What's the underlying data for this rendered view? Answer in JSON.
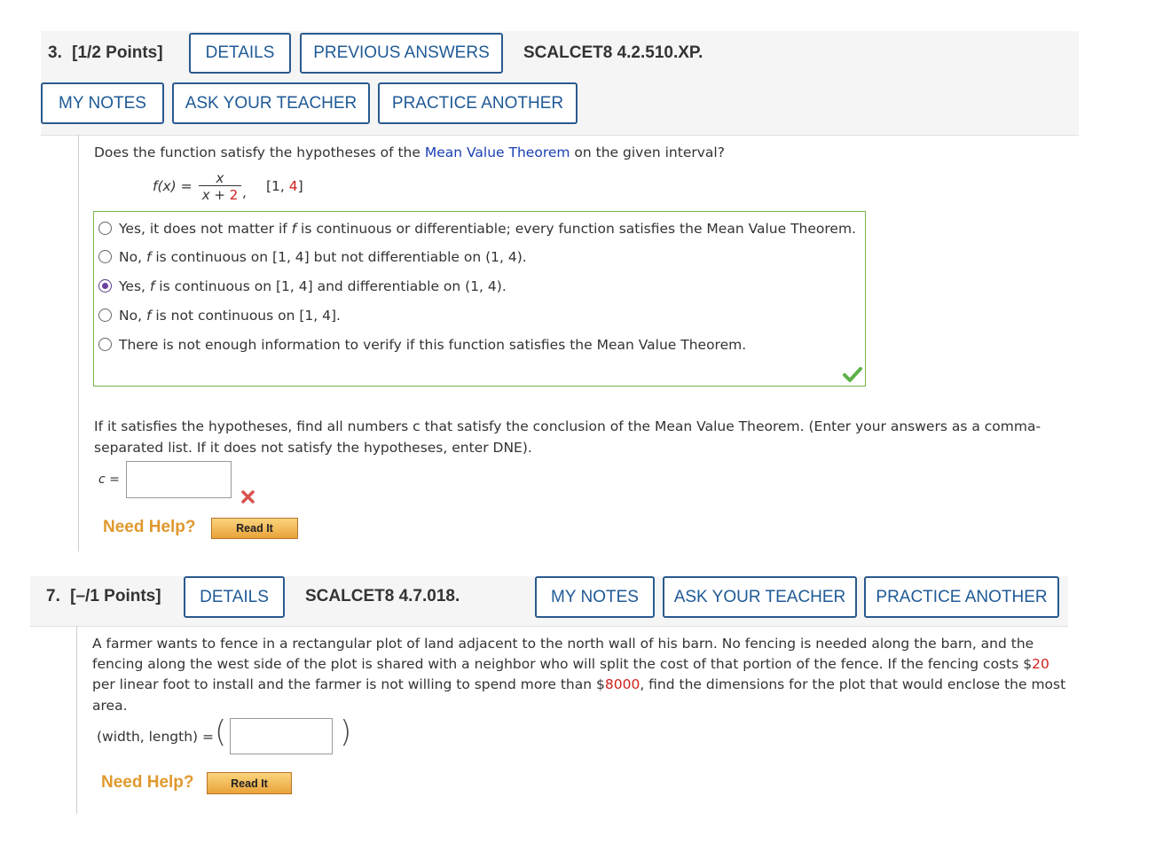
{
  "q3": {
    "number": "3.",
    "points": "[1/2 Points]",
    "details_label": "DETAILS",
    "previous_answers_label": "PREVIOUS ANSWERS",
    "code": "SCALCET8 4.2.510.XP.",
    "my_notes_label": "MY NOTES",
    "ask_teacher_label": "ASK YOUR TEACHER",
    "practice_another_label": "PRACTICE ANOTHER",
    "question_pre": "Does the function satisfy the hypotheses of the ",
    "question_link": "Mean Value Theorem",
    "question_post": " on the given interval?",
    "function_lhs": "f(x) =",
    "frac_num": "x",
    "frac_den_pre": "x + ",
    "frac_den_val": "2",
    "interval_pre": "[1, ",
    "interval_val": "4",
    "interval_post": "]",
    "options": [
      {
        "pre": "Yes, it does not matter if ",
        "f": "f",
        "post": " is continuous or differentiable; every function satisfies the Mean Value Theorem.",
        "selected": false
      },
      {
        "pre": "No, ",
        "f": "f",
        "post": " is continuous on [1, 4] but not differentiable on (1, 4).",
        "selected": false
      },
      {
        "pre": "Yes, ",
        "f": "f",
        "post": " is continuous on [1, 4] and differentiable on (1, 4).",
        "selected": true
      },
      {
        "pre": "No, ",
        "f": "f",
        "post": " is not continuous on [1, 4].",
        "selected": false
      },
      {
        "pre": "There is not enough information to verify if this function satisfies the Mean Value Theorem.",
        "f": "",
        "post": "",
        "selected": false
      }
    ],
    "part2_line1": "If it satisfies the hypotheses, find all numbers c that satisfy the conclusion of the Mean Value Theorem. (Enter your answers as a comma-",
    "part2_line2": "separated list. If it does not satisfy the hypotheses, enter DNE).",
    "c_label": "c =",
    "c_value": "",
    "need_help": "Need Help?",
    "read_it": "Read It"
  },
  "q7": {
    "number": "7.",
    "points": "[–/1 Points]",
    "details_label": "DETAILS",
    "code": "SCALCET8 4.7.018.",
    "my_notes_label": "MY NOTES",
    "ask_teacher_label": "ASK YOUR TEACHER",
    "practice_another_label": "PRACTICE ANOTHER",
    "line1": "A farmer wants to fence in a rectangular plot of land adjacent to the north wall of his barn. No fencing is needed along the barn, and the",
    "line2_pre": "fencing along the west side of the plot is shared with a neighbor who will split the cost of that portion of the fence. If the fencing costs $",
    "line2_val": "20",
    "line3_pre": "per linear foot to install and the farmer is not willing to spend more than $",
    "line3_val": "8000",
    "line3_post": ", find the dimensions for the plot that would enclose the most",
    "line4": "area.",
    "answer_label": "(width, length) =",
    "answer_value": "",
    "need_help": "Need Help?",
    "read_it": "Read It"
  },
  "colors": {
    "button_border": "#2a5a8e",
    "link": "#1a3fb5",
    "correct": "#5cb247",
    "incorrect": "#d9534f",
    "need_help": "#e0992e",
    "red_value": "#d0211c"
  }
}
